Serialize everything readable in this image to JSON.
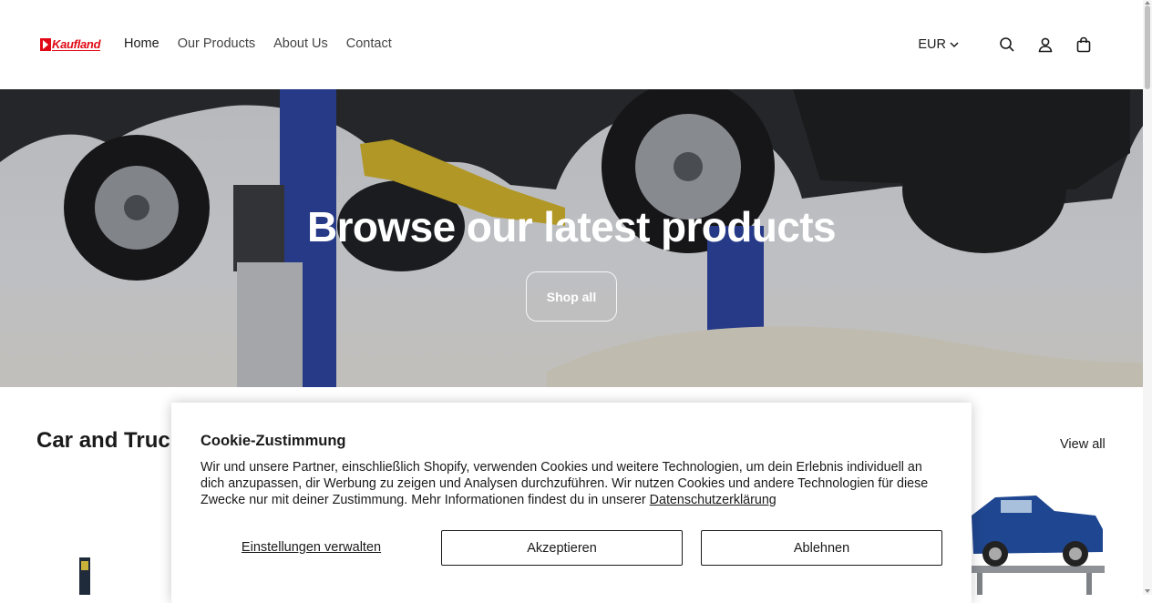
{
  "brand": {
    "logo_text": "Kaufland",
    "color": "#e10915"
  },
  "nav": {
    "items": [
      {
        "label": "Home",
        "active": true
      },
      {
        "label": "Our Products",
        "active": false
      },
      {
        "label": "About Us",
        "active": false
      },
      {
        "label": "Contact",
        "active": false
      }
    ]
  },
  "header": {
    "currency": "EUR",
    "icons": [
      "search-icon",
      "account-icon",
      "cart-icon"
    ]
  },
  "hero": {
    "title": "Browse our latest products",
    "button_label": "Shop all"
  },
  "collection": {
    "title": "Car and Truck",
    "view_all_label": "View all"
  },
  "cookie": {
    "title": "Cookie-Zustimmung",
    "text": "Wir und unsere Partner, einschließlich Shopify, verwenden Cookies und weitere Technologien, um dein Erlebnis individuell an dich anzupassen, dir Werbung zu zeigen und Analysen durchzuführen. Wir nutzen Cookies und andere Technologien für diese Zwecke nur mit deiner Zustimmung. Mehr Informationen findest du in unserer ",
    "link_label": "Datenschutzerklärung",
    "manage_label": "Einstellungen verwalten",
    "accept_label": "Akzeptieren",
    "decline_label": "Ablehnen"
  }
}
